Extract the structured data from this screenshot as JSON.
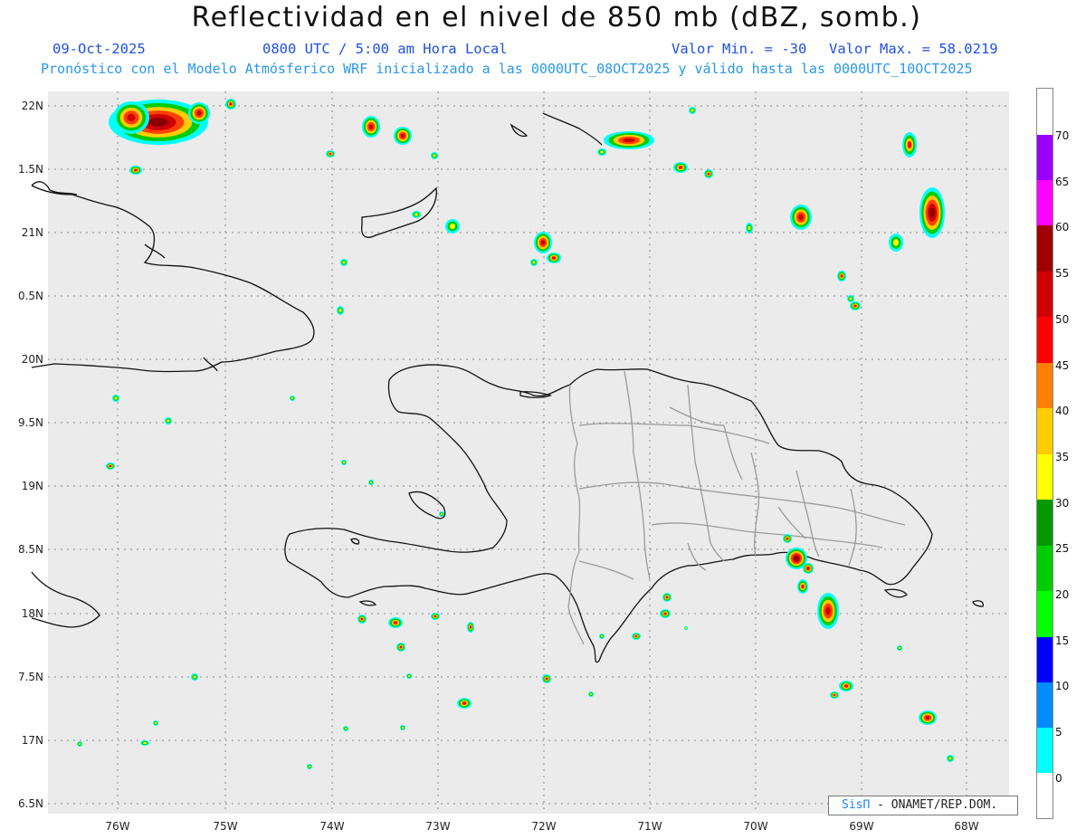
{
  "header": {
    "title": "Reflectividad en el nivel de 850 mb (dBZ, somb.)",
    "date": "09-Oct-2025",
    "time": "0800 UTC / 5:00 am Hora Local",
    "valmin": "Valor Min. = -30",
    "valmax": "Valor Max. = 58.0219",
    "model": "Pronóstico con el Modelo Atmósferico WRF inicializado a las 0000UTC_08OCT2025 y válido hasta las  0000UTC_10OCT2025",
    "color": "#1f4fe0"
  },
  "map": {
    "lon_labels": [
      "76W",
      "75W",
      "74W",
      "73W",
      "72W",
      "71W",
      "70W",
      "69W",
      "68W"
    ],
    "lat_labels": [
      "22N",
      "1.5N",
      "21N",
      "0.5N",
      "20N",
      "9.5N",
      "19N",
      "8.5N",
      "18N",
      "7.5N",
      "17N",
      "6.5N"
    ],
    "background": "#ebebeb",
    "grid": "dotted"
  },
  "colorbar": {
    "labels": [
      "70",
      "65",
      "60",
      "55",
      "50",
      "45",
      "40",
      "35",
      "30",
      "25",
      "20",
      "15",
      "10",
      "5",
      "0"
    ],
    "colors": [
      "#9a00ff",
      "#ff00ff",
      "#a00000",
      "#d00000",
      "#ff0000",
      "#ff7f00",
      "#ffcc00",
      "#ffff00",
      "#009900",
      "#00cc00",
      "#00ff00",
      "#0000ff",
      "#008cff",
      "#00ffff",
      "#ffffff",
      "#e8e8e8"
    ]
  },
  "credit": {
    "logo": "SisΠ",
    "text": " - ONAMET/REP.DOM."
  }
}
